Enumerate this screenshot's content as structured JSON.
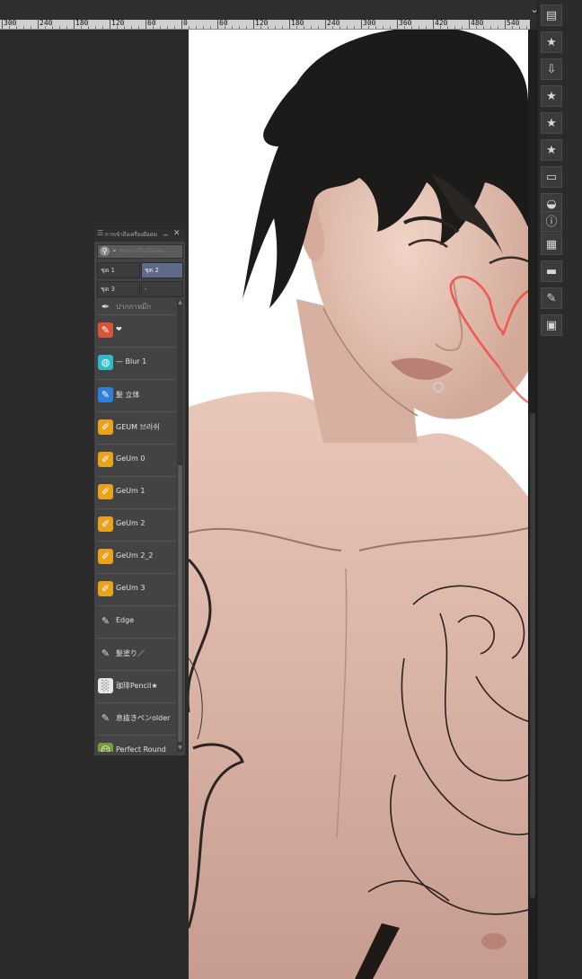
{
  "ruler": {
    "labels": [
      "300",
      "240",
      "180",
      "120",
      "60",
      "0",
      "60",
      "120",
      "180",
      "240",
      "300",
      "360",
      "420",
      "480",
      "540"
    ]
  },
  "panel": {
    "title": "การเข้าถึงเครื่องมือย่อย",
    "search_placeholder": "ค้นหาเครื่องมือย่อย",
    "group_tabs": [
      "ชุด 1",
      "ชุด 2",
      "ชุด 3",
      "-"
    ],
    "active_tab": "ชุด 2",
    "items": [
      {
        "label": "ปากกาหมึก",
        "icon": "pen-nib-icon",
        "icon_color": "#434343",
        "glyph": "✒"
      },
      {
        "label": "❤",
        "icon": "heart-brush-icon",
        "icon_color": "#d65438",
        "glyph": "✎"
      },
      {
        "label": "— Blur 1",
        "icon": "blur-brush-icon",
        "icon_color": "#2fb9c9",
        "glyph": "◍"
      },
      {
        "label": "髪 立体",
        "icon": "hair-brush-icon",
        "icon_color": "#2d7fe0",
        "glyph": "✎"
      },
      {
        "label": "GEUM 브러쉬",
        "icon": "geum-brush-icon",
        "icon_color": "#e9a21a",
        "glyph": "✐"
      },
      {
        "label": "GeUm 0",
        "icon": "geum-brush-icon",
        "icon_color": "#e9a21a",
        "glyph": "✐"
      },
      {
        "label": "GeUm 1",
        "icon": "geum-brush-icon",
        "icon_color": "#e9a21a",
        "glyph": "✐"
      },
      {
        "label": "GeUm 2",
        "icon": "geum-brush-icon",
        "icon_color": "#e9a21a",
        "glyph": "✐"
      },
      {
        "label": "GeUm 2_2",
        "icon": "geum-brush-icon",
        "icon_color": "#e9a21a",
        "glyph": "✐"
      },
      {
        "label": "GeUm 3",
        "icon": "geum-brush-icon",
        "icon_color": "#e9a21a",
        "glyph": "✐"
      },
      {
        "label": "Edge",
        "icon": "pencil-icon",
        "icon_color": "#434343",
        "glyph": "✎"
      },
      {
        "label": "髪塗り／",
        "icon": "pencil-icon",
        "icon_color": "#434343",
        "glyph": "✎"
      },
      {
        "label": "珈琲Pencil★",
        "icon": "pencil-texture-icon",
        "icon_color": "#e6e6e6",
        "glyph": "░"
      },
      {
        "label": "息抜きペンolder",
        "icon": "pen-icon",
        "icon_color": "#434343",
        "glyph": "✎"
      },
      {
        "label": "Perfect Round",
        "icon": "avatar-brush-icon",
        "icon_color": "#7a9a3a",
        "glyph": "☺"
      }
    ]
  },
  "right_strip": {
    "icons": [
      "layer-property-icon",
      "favorite-icon",
      "import-icon",
      "favorite-icon",
      "favorite-icon",
      "favorite-icon",
      "save-icon",
      "history-icon",
      "info-icon",
      "calendar-icon",
      "navigator-icon",
      "edit-icon",
      "folder-icon"
    ]
  },
  "colors": {
    "accent_tab": "#5d6b86",
    "heart_stroke": "#f2574f"
  }
}
